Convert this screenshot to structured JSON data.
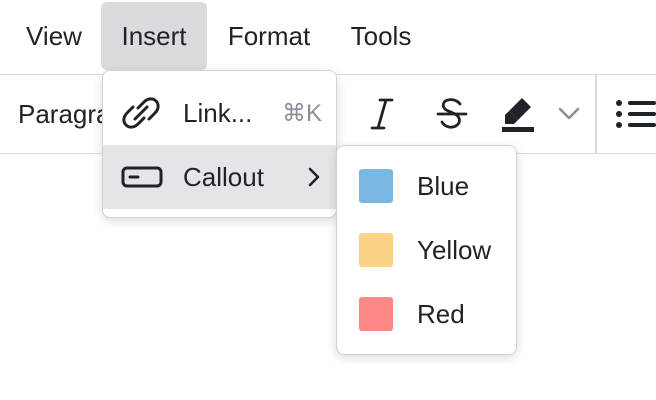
{
  "menubar": {
    "items": [
      {
        "label": "View"
      },
      {
        "label": "Insert",
        "active": true
      },
      {
        "label": "Format"
      },
      {
        "label": "Tools"
      }
    ]
  },
  "toolbar": {
    "block_type_label": "Paragraph",
    "buttons": [
      "italic",
      "strikethrough",
      "highlight",
      "highlight-dropdown",
      "bullet-list"
    ]
  },
  "insert_menu": {
    "items": [
      {
        "icon": "link-icon",
        "label": "Link...",
        "shortcut": "⌘K"
      },
      {
        "icon": "callout-icon",
        "label": "Callout",
        "has_submenu": true,
        "highlighted": true
      }
    ]
  },
  "callout_submenu": {
    "items": [
      {
        "label": "Blue",
        "color": "#79b8e2"
      },
      {
        "label": "Yellow",
        "color": "#fad387"
      },
      {
        "label": "Red",
        "color": "#fd8888"
      }
    ]
  }
}
